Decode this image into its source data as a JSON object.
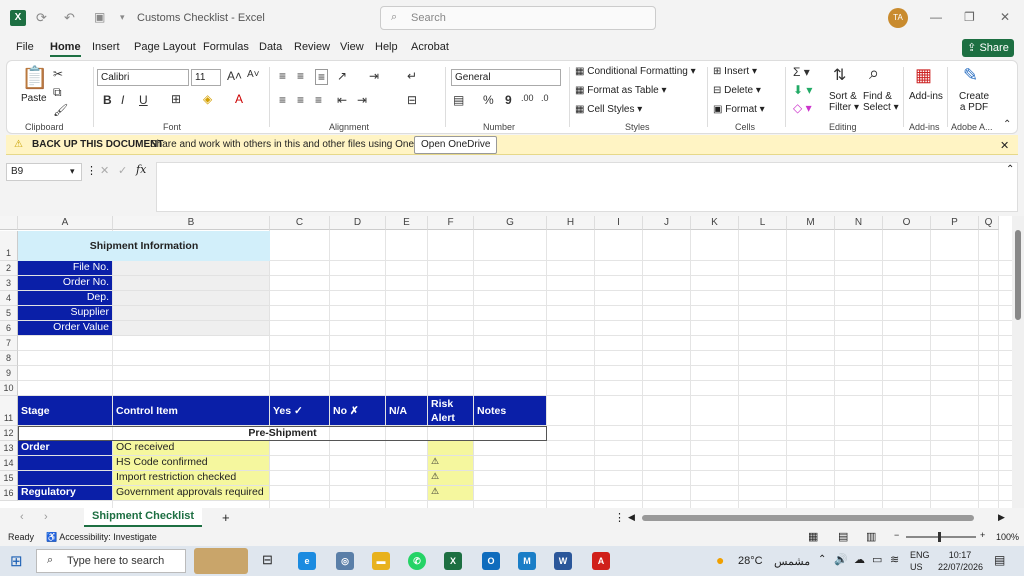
{
  "window": {
    "title": "Customs Checklist",
    "app": "Excel",
    "search_placeholder": "Search",
    "user_initials": "TA"
  },
  "menu": [
    "File",
    "Home",
    "Insert",
    "Page Layout",
    "Formulas",
    "Data",
    "Review",
    "View",
    "Help",
    "Acrobat"
  ],
  "share_label": "Share",
  "ribbon": {
    "paste": "Paste",
    "font_name": "Calibri",
    "font_size": "11",
    "number_format": "General",
    "conditional_formatting": "Conditional Formatting",
    "format_as_table": "Format as Table",
    "cell_styles": "Cell Styles",
    "insert": "Insert",
    "delete": "Delete",
    "format": "Format",
    "sort_filter": "Sort &",
    "sort_filter2": "Filter",
    "find_select": "Find &",
    "find_select2": "Select",
    "add_ins": "Add-ins",
    "create_pdf": "Create",
    "create_pdf2": "a PDF",
    "groups": {
      "clipboard": "Clipboard",
      "font": "Font",
      "alignment": "Alignment",
      "number": "Number",
      "styles": "Styles",
      "cells": "Cells",
      "editing": "Editing",
      "addins": "Add-ins",
      "adobe": "Adobe A..."
    }
  },
  "infobar": {
    "title": "BACK UP THIS DOCUMENT",
    "message": "Share and work with others in this and other files using OneDrive.",
    "button": "Open OneDrive"
  },
  "namebox": "B9",
  "fx": "fx",
  "columns": [
    "A",
    "B",
    "C",
    "D",
    "E",
    "F",
    "G",
    "H",
    "I",
    "J",
    "K",
    "L",
    "M",
    "N",
    "O",
    "P",
    "Q"
  ],
  "rows": [
    "1",
    "2",
    "3",
    "4",
    "5",
    "6",
    "7",
    "8",
    "9",
    "10",
    "11",
    "12",
    "13",
    "14",
    "15",
    "16"
  ],
  "sheet": {
    "shipment_info": "Shipment Information",
    "file_no": "File No.",
    "order_no": "Order No.",
    "dep": "Dep.",
    "supplier": "Supplier",
    "order_value": "Order Value",
    "h_stage": "Stage",
    "h_control": "Control Item",
    "h_yes": "Yes ✓",
    "h_no": "No ✗",
    "h_na": "N/A",
    "h_risk": "Risk",
    "h_risk2": "Alert",
    "h_notes": "Notes",
    "pre_shipment": "Pre-Shipment",
    "stage_order": "Order",
    "stage_regulatory": "Regulatory",
    "item1": "OC received",
    "item2": "HS Code confirmed",
    "item3": "Import restriction checked",
    "item4": "Government approvals required",
    "alert": "⚠"
  },
  "sheet_tab": "Shipment Checklist",
  "status": {
    "ready": "Ready",
    "accessibility": "Accessibility: Investigate",
    "zoom": "100%"
  },
  "taskbar": {
    "search": "Type here to search",
    "weather": "28°C",
    "weather_text": "مشمس",
    "lang": "ENG",
    "region": "US",
    "time": "10:17",
    "date": "22/07/2026"
  }
}
